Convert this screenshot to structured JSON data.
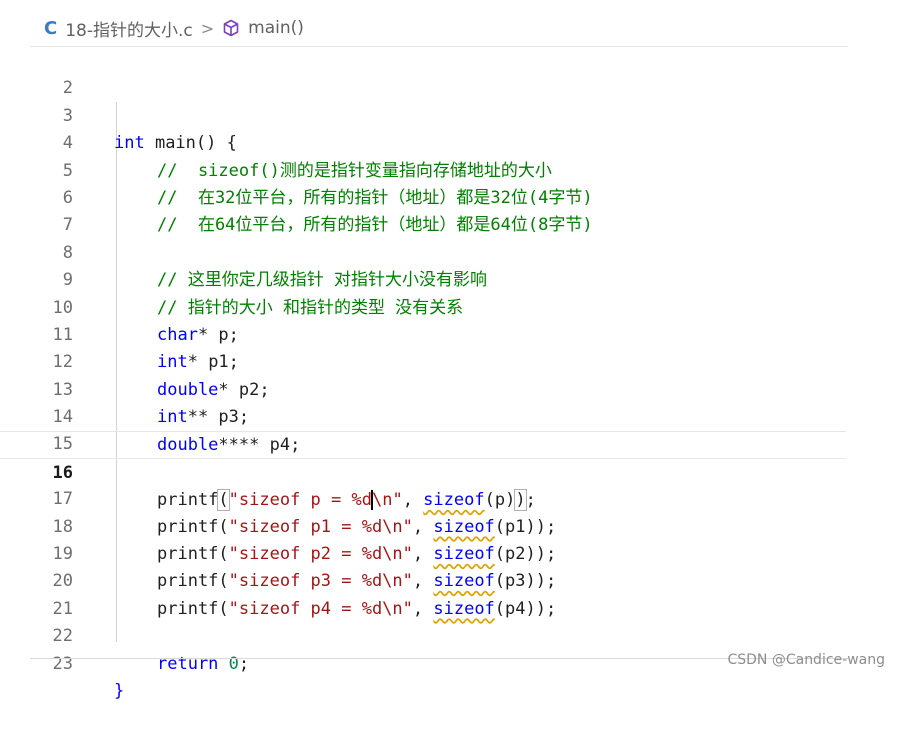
{
  "breadcrumb": {
    "file_icon": "C",
    "file_name": "18-指针的大小.c",
    "separator": ">",
    "symbol": "main()"
  },
  "editor": {
    "lines": [
      {
        "num": "2"
      },
      {
        "num": "3",
        "t": [
          "int",
          " main() {"
        ]
      },
      {
        "num": "4",
        "comment": "//  sizeof()测的是指针变量指向存储地址的大小"
      },
      {
        "num": "5",
        "comment": "//  在32位平台，所有的指针（地址）都是32位(4字节)"
      },
      {
        "num": "6",
        "comment": "//  在64位平台，所有的指针（地址）都是64位(8字节)"
      },
      {
        "num": "7"
      },
      {
        "num": "8",
        "comment": "// 这里你定几级指针 对指针大小没有影响"
      },
      {
        "num": "9",
        "comment": "// 指针的大小 和指针的类型 没有关系"
      },
      {
        "num": "10",
        "t": [
          "char",
          "* p;"
        ]
      },
      {
        "num": "11",
        "t": [
          "int",
          "* p1;"
        ]
      },
      {
        "num": "12",
        "t": [
          "double",
          "* p2;"
        ]
      },
      {
        "num": "13",
        "t": [
          "int",
          "** p3;"
        ]
      },
      {
        "num": "14",
        "t": [
          "double",
          "**** p4;"
        ]
      },
      {
        "num": "15"
      },
      {
        "num": "16",
        "p": [
          "printf",
          "(",
          "\"sizeof p = %d",
          "\\n\"",
          ", ",
          "sizeof",
          "(p)",
          ")",
          ";"
        ]
      },
      {
        "num": "17",
        "p": [
          "printf(",
          "\"sizeof p1 = %d\\n\"",
          ", ",
          "sizeof",
          "(p1));"
        ]
      },
      {
        "num": "18",
        "p": [
          "printf(",
          "\"sizeof p2 = %d\\n\"",
          ", ",
          "sizeof",
          "(p2));"
        ]
      },
      {
        "num": "19",
        "p": [
          "printf(",
          "\"sizeof p3 = %d\\n\"",
          ", ",
          "sizeof",
          "(p3));"
        ]
      },
      {
        "num": "20",
        "p": [
          "printf(",
          "\"sizeof p4 = %d\\n\"",
          ", ",
          "sizeof",
          "(p4));"
        ]
      },
      {
        "num": "21"
      },
      {
        "num": "22",
        "r": [
          "return",
          " ",
          "0",
          ";"
        ]
      },
      {
        "num": "23",
        "t": [
          "}"
        ]
      }
    ]
  },
  "watermark": "CSDN @Candice-wang",
  "colors": {
    "keyword": "#0000ff",
    "comment": "#008000",
    "string": "#a31515",
    "number": "#098658"
  }
}
